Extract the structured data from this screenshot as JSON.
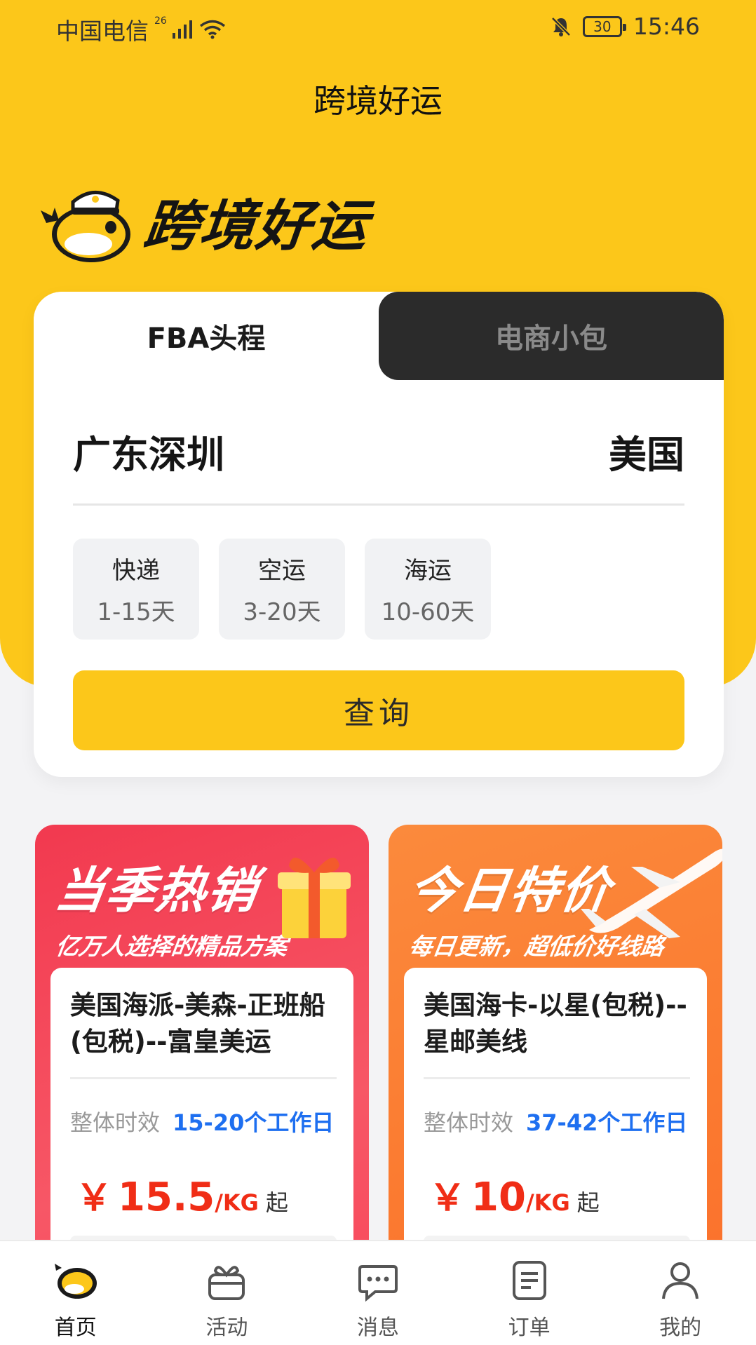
{
  "status_bar": {
    "carrier": "中国电信",
    "network": "26",
    "battery": "30",
    "time": "15:46"
  },
  "header": {
    "title": "跨境好运"
  },
  "brand": {
    "name": "跨境好运"
  },
  "search": {
    "tabs": [
      {
        "label": "FBA头程",
        "active": true
      },
      {
        "label": "电商小包",
        "active": false
      }
    ],
    "origin": "广东深圳",
    "destination": "美国",
    "transport_options": [
      {
        "name": "快递",
        "days": "1-15天"
      },
      {
        "name": "空运",
        "days": "3-20天"
      },
      {
        "name": "海运",
        "days": "10-60天"
      }
    ],
    "query_label": "查询"
  },
  "promos": [
    {
      "title": "当季热销",
      "subtitle": "亿万人选择的精品方案",
      "route": {
        "name": "美国海派-美森-正班船(包税)--富皇美运",
        "time_label": "整体时效",
        "time_value": "15-20个工作日",
        "currency": "￥",
        "price": "15.5",
        "unit": "/KG",
        "suffix": "起"
      }
    },
    {
      "title": "今日特价",
      "subtitle": "每日更新，超低价好线路",
      "route": {
        "name": "美国海卡-以星(包税)--星邮美线",
        "time_label": "整体时效",
        "time_value": "37-42个工作日",
        "currency": "￥",
        "price": "10",
        "unit": "/KG",
        "suffix": "起"
      }
    }
  ],
  "bottom_nav": [
    {
      "label": "首页",
      "icon": "whale-home-icon",
      "active": true
    },
    {
      "label": "活动",
      "icon": "gift-icon",
      "active": false
    },
    {
      "label": "消息",
      "icon": "chat-bubble-icon",
      "active": false
    },
    {
      "label": "订单",
      "icon": "document-icon",
      "active": false
    },
    {
      "label": "我的",
      "icon": "user-icon",
      "active": false
    }
  ],
  "colors": {
    "brand_yellow": "#fcc71a",
    "hot_red": "#f2394f",
    "deal_orange": "#fb8a3c",
    "price_red": "#f02d16",
    "time_blue": "#1e6ff0"
  }
}
